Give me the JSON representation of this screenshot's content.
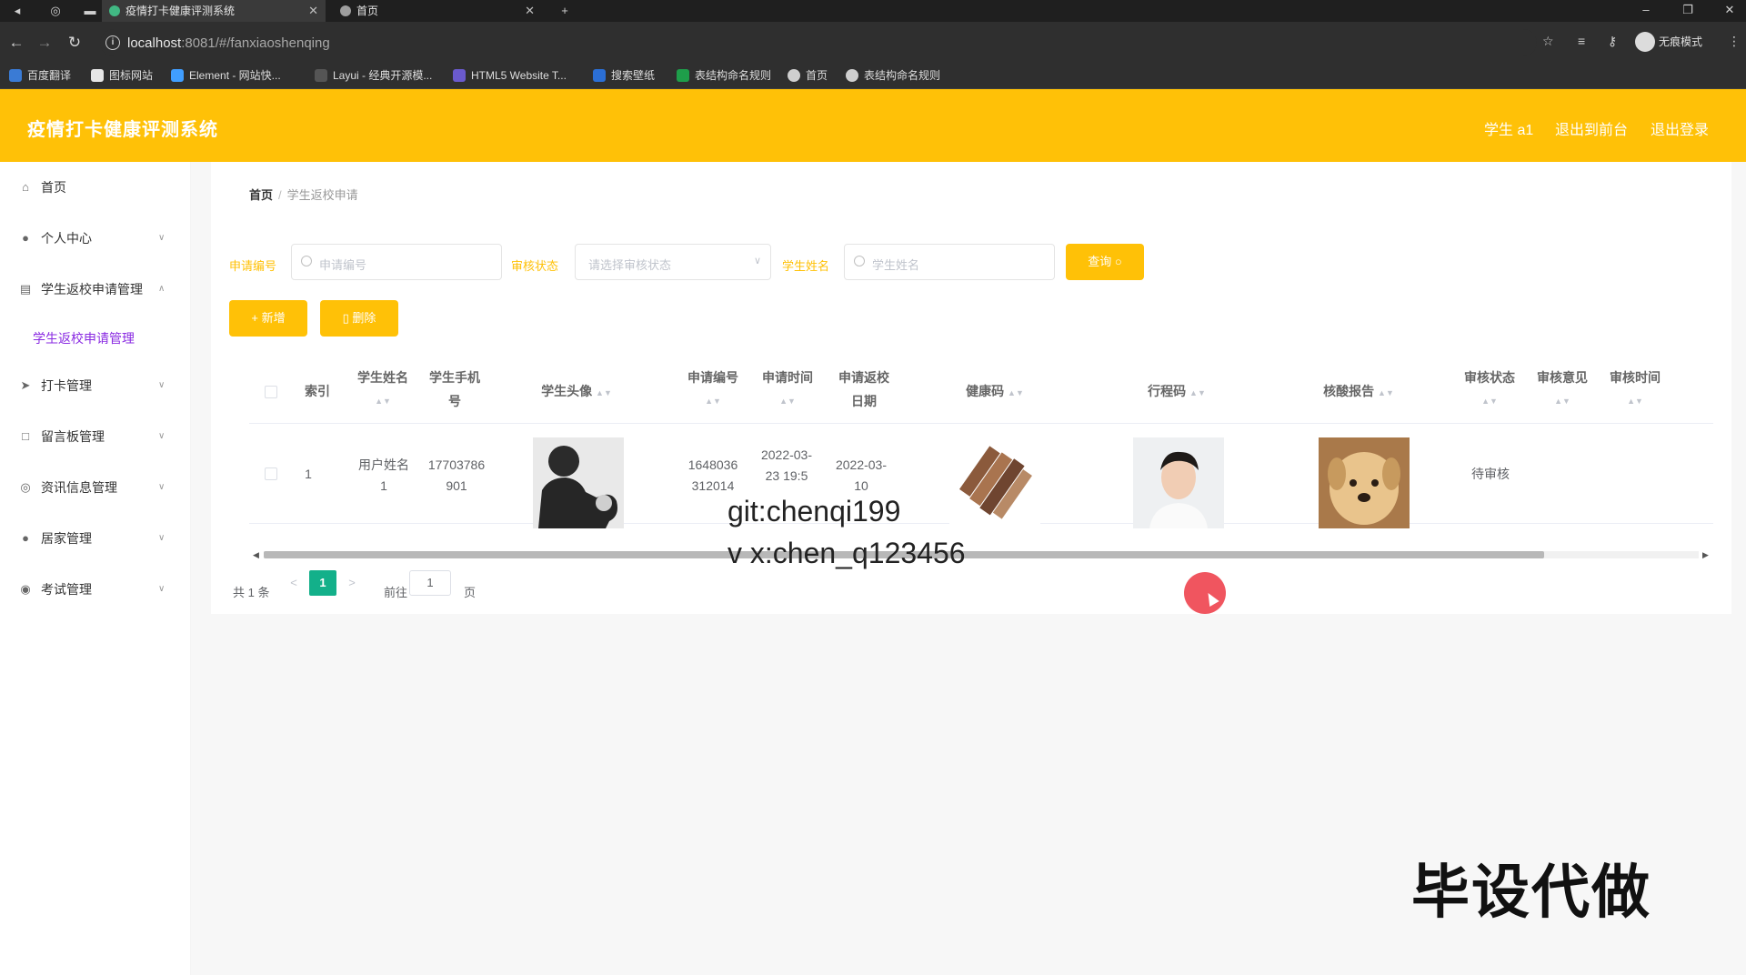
{
  "browser": {
    "tabs": [
      {
        "title": "疫情打卡健康评测系统",
        "active": true
      },
      {
        "title": "首页",
        "active": false
      }
    ],
    "new_tab": "+",
    "url_host": "localhost",
    "url_rest": ":8081/#/fanxiaoshenqing",
    "profile_label": "无痕模式",
    "bookmarks": [
      "百度翻译",
      "图标网站",
      "Element - 网站快...",
      "Layui - 经典开源模...",
      "HTML5 Website T...",
      "搜索壁纸",
      "表结构命名规则",
      "首页",
      "表结构命名规则"
    ]
  },
  "header": {
    "title": "疫情打卡健康评测系统",
    "links": [
      "学生 a1",
      "退出到前台",
      "退出登录"
    ]
  },
  "sidebar": {
    "items": [
      {
        "label": "首页",
        "icon": "home-icon",
        "has_arrow": false
      },
      {
        "label": "个人中心",
        "icon": "user-icon",
        "has_arrow": true
      },
      {
        "label": "学生返校申请管理",
        "icon": "document-icon",
        "has_arrow": true,
        "expanded": true
      },
      {
        "label": "打卡管理",
        "icon": "send-icon",
        "has_arrow": true
      },
      {
        "label": "留言板管理",
        "icon": "message-icon",
        "has_arrow": true
      },
      {
        "label": "资讯信息管理",
        "icon": "compass-icon",
        "has_arrow": true
      },
      {
        "label": "居家管理",
        "icon": "user-icon",
        "has_arrow": true
      },
      {
        "label": "考试管理",
        "icon": "bulb-icon",
        "has_arrow": true
      }
    ],
    "subitem": "学生返校申请管理"
  },
  "breadcrumb": {
    "home": "首页",
    "separator": "/",
    "current": "学生返校申请"
  },
  "search": {
    "apply_no_label": "申请编号",
    "apply_no_placeholder": "申请编号",
    "status_label": "审核状态",
    "status_placeholder": "请选择审核状态",
    "name_label": "学生姓名",
    "name_placeholder": "学生姓名",
    "query_button": "查询"
  },
  "actions": {
    "add": "新增",
    "delete": "删除"
  },
  "table": {
    "columns": [
      "索引",
      "学生姓名",
      "学生手机号",
      "学生头像",
      "申请编号",
      "申请时间",
      "申请返校日期",
      "健康码",
      "行程码",
      "核酸报告",
      "审核状态",
      "审核意见",
      "审核时间"
    ],
    "rows": [
      {
        "index": "1",
        "name": "用户姓名1",
        "phone": "17703786901",
        "apply_no": "1648036312014",
        "apply_time": "2022-03-23 19:5",
        "return_date": "2022-03-10",
        "status": "待审核"
      }
    ]
  },
  "pagination": {
    "total": "共 1 条",
    "prev": "<",
    "current": "1",
    "next": ">",
    "goto_prefix": "前往",
    "goto_value": "1",
    "goto_suffix": "页"
  },
  "overlays": {
    "watermark_git": "git:chenqi199",
    "watermark_vx": "v x:chen_q123456",
    "stamp": "毕设代做"
  },
  "colors": {
    "accent": "#ffc107",
    "active_submenu": "#8a2be2",
    "page_current": "#13b08a"
  }
}
